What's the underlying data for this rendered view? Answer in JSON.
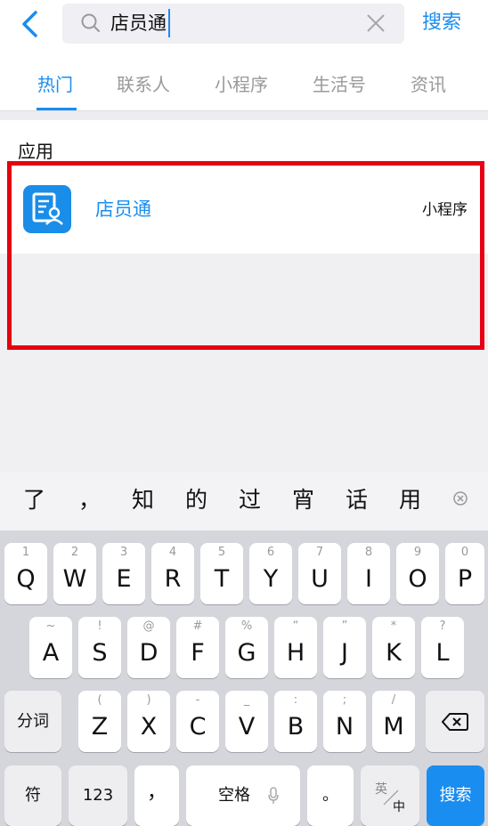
{
  "header": {
    "search_value": "店员通",
    "search_button_label": "搜索"
  },
  "tabs": [
    {
      "label": "热门",
      "active": true
    },
    {
      "label": "联系人",
      "active": false
    },
    {
      "label": "小程序",
      "active": false
    },
    {
      "label": "生活号",
      "active": false
    },
    {
      "label": "资讯",
      "active": false
    }
  ],
  "results": {
    "section_label": "应用",
    "items": [
      {
        "name": "店员通",
        "type": "小程序",
        "icon": "form-user-icon"
      }
    ]
  },
  "candidates": [
    "了",
    "，",
    "知",
    "的",
    "过",
    "宵",
    "话",
    "用"
  ],
  "keyboard": {
    "row1": [
      {
        "sub": "1",
        "main": "Q"
      },
      {
        "sub": "2",
        "main": "W"
      },
      {
        "sub": "3",
        "main": "E"
      },
      {
        "sub": "4",
        "main": "R"
      },
      {
        "sub": "5",
        "main": "T"
      },
      {
        "sub": "6",
        "main": "Y"
      },
      {
        "sub": "7",
        "main": "U"
      },
      {
        "sub": "8",
        "main": "I"
      },
      {
        "sub": "9",
        "main": "O"
      },
      {
        "sub": "0",
        "main": "P"
      }
    ],
    "row2": [
      {
        "sub": "~",
        "main": "A"
      },
      {
        "sub": "!",
        "main": "S"
      },
      {
        "sub": "@",
        "main": "D"
      },
      {
        "sub": "#",
        "main": "F"
      },
      {
        "sub": "%",
        "main": "G"
      },
      {
        "sub": "“",
        "main": "H"
      },
      {
        "sub": "”",
        "main": "J"
      },
      {
        "sub": "*",
        "main": "K"
      },
      {
        "sub": "?",
        "main": "L"
      }
    ],
    "row3": [
      {
        "sub": "(",
        "main": "Z"
      },
      {
        "sub": ")",
        "main": "X"
      },
      {
        "sub": "-",
        "main": "C"
      },
      {
        "sub": "_",
        "main": "V"
      },
      {
        "sub": ":",
        "main": "B"
      },
      {
        "sub": ";",
        "main": "N"
      },
      {
        "sub": "/",
        "main": "M"
      }
    ],
    "fenci_label": "分词",
    "symbol_label": "符",
    "num_label": "123",
    "comma_label": "，",
    "space_label": "空格",
    "period_label": "。",
    "lang_top": "英",
    "lang_bottom": "中",
    "search_label": "搜索"
  },
  "colors": {
    "accent": "#1a8df0",
    "highlight_border": "#e60012"
  }
}
